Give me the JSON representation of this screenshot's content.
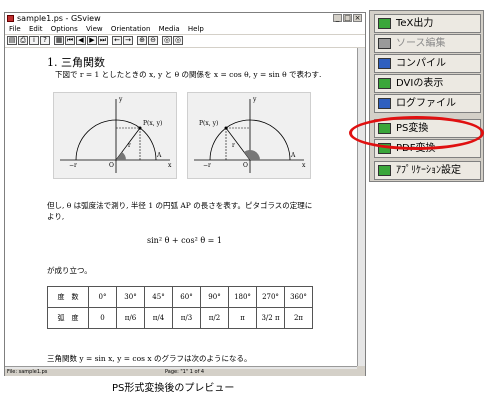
{
  "window": {
    "title": "sample1.ps - GSview",
    "controls": [
      "_",
      "□",
      "×"
    ]
  },
  "menubar": [
    "File",
    "Edit",
    "Options",
    "View",
    "Orientation",
    "Media",
    "Help"
  ],
  "toolbar": [
    {
      "icon": "open-icon",
      "glyph": "▤"
    },
    {
      "icon": "print-icon",
      "glyph": "⎙"
    },
    {
      "icon": "info-icon",
      "glyph": "i"
    },
    {
      "icon": "help-icon",
      "glyph": "?"
    },
    {
      "icon": "goto-page-icon",
      "glyph": "▦"
    },
    {
      "icon": "first-page-icon",
      "glyph": "⏮"
    },
    {
      "icon": "prev-page-icon",
      "glyph": "◀"
    },
    {
      "icon": "next-page-icon",
      "glyph": "▶"
    },
    {
      "icon": "last-page-icon",
      "glyph": "⏭"
    },
    {
      "icon": "back-icon",
      "glyph": "←"
    },
    {
      "icon": "forward-icon",
      "glyph": "→"
    },
    {
      "icon": "zoom-in-icon",
      "glyph": "⊕"
    },
    {
      "icon": "zoom-out-icon",
      "glyph": "⊖"
    },
    {
      "icon": "magnify-icon",
      "glyph": "◎"
    },
    {
      "icon": "magnify-icon",
      "glyph": "◎"
    }
  ],
  "document": {
    "heading": "1. 三角関数",
    "intro": "下図で r = 1 としたときの x, y と θ の関係を x = cos θ, y = sin θ で表わす.",
    "figure_left": {
      "r": "r",
      "minus_r": "−r",
      "origin": "O",
      "x_axis": "x",
      "y_axis": "y",
      "point": "P(x, y)",
      "point_a": "A"
    },
    "figure_right": {
      "r": "r",
      "minus_r": "−r",
      "origin": "O",
      "x_axis": "x",
      "y_axis": "y",
      "point": "P(x, y)",
      "point_a": "A"
    },
    "para1": "但し, θ は弧度法で測り, 半径 1 の円弧 AP の長さを表す。ピタゴラスの定理に",
    "para2": "より,",
    "equation": "sin² θ + cos² θ = 1",
    "para3": "が成り立つ。",
    "table": {
      "row1_header": "度　数",
      "row1": [
        "0°",
        "30°",
        "45°",
        "60°",
        "90°",
        "180°",
        "270°",
        "360°"
      ],
      "row2_header": "弧　度",
      "row2": [
        "0",
        "π/6",
        "π/4",
        "π/3",
        "π/2",
        "π",
        "3/2 π",
        "2π"
      ]
    },
    "para4": "三角関数 y = sin x, y = cos x のグラフは次のようになる。"
  },
  "statusbar": {
    "file": "File: sample1.ps",
    "page": "Page: \"1\" 1 of 4"
  },
  "menu_panel": {
    "items": [
      {
        "label": "TeX出力",
        "icon": "tex-output-icon",
        "enabled": true,
        "color": "#3aa63a"
      },
      {
        "label": "ソース編集",
        "icon": "edit-source-icon",
        "enabled": false,
        "color": "#9a9a9a"
      },
      {
        "label": "コンパイル",
        "icon": "compile-icon",
        "enabled": true,
        "color": "#2f5fbf"
      },
      {
        "label": "DVIの表示",
        "icon": "dvi-view-icon",
        "enabled": true,
        "color": "#3aa63a"
      },
      {
        "label": "ログファイル",
        "icon": "log-file-icon",
        "enabled": true,
        "color": "#2f5fbf"
      },
      {
        "label": "PS変換",
        "icon": "ps-convert-icon",
        "enabled": true,
        "color": "#3aa63a"
      },
      {
        "label": "PDF変換",
        "icon": "pdf-convert-icon",
        "enabled": true,
        "color": "#3aa63a"
      },
      {
        "label": "ｱﾌﾟﾘｹｰｼｮﾝ設定",
        "icon": "app-settings-icon",
        "enabled": true,
        "color": "#3aa63a"
      }
    ]
  },
  "highlight_color": "#e01010",
  "caption": "PS形式変換後のプレビュー"
}
